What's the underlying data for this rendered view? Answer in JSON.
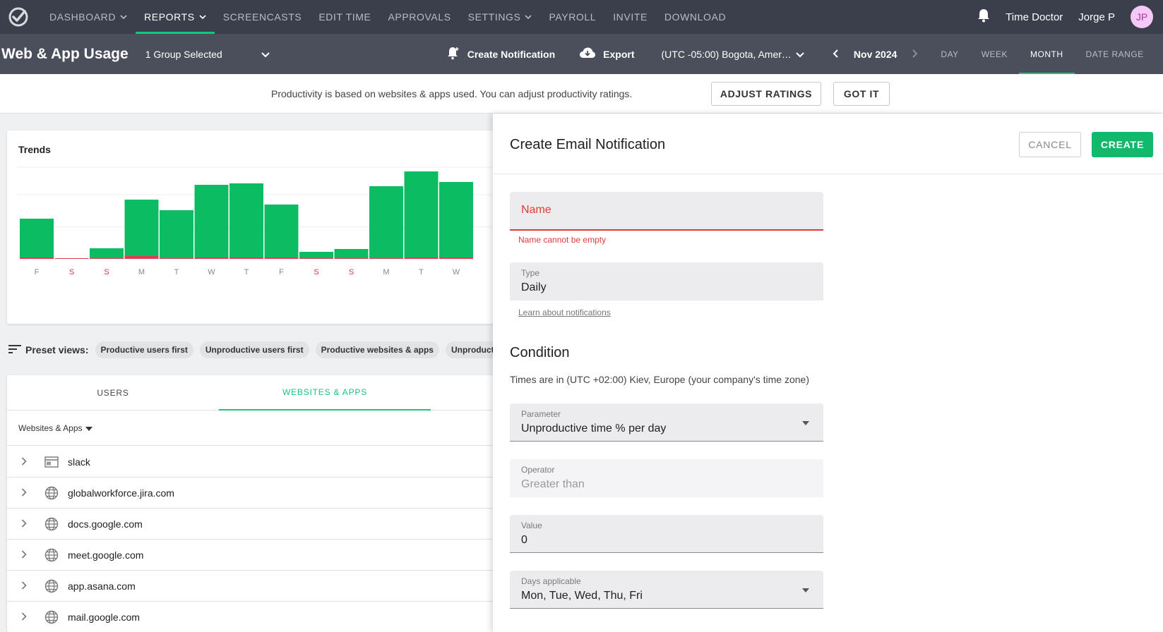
{
  "nav": {
    "items": [
      {
        "label": "DASHBOARD",
        "has_caret": true,
        "active": false
      },
      {
        "label": "REPORTS",
        "has_caret": true,
        "active": true
      },
      {
        "label": "SCREENCASTS",
        "has_caret": false,
        "active": false
      },
      {
        "label": "EDIT TIME",
        "has_caret": false,
        "active": false
      },
      {
        "label": "APPROVALS",
        "has_caret": false,
        "active": false
      },
      {
        "label": "SETTINGS",
        "has_caret": true,
        "active": false
      },
      {
        "label": "PAYROLL",
        "has_caret": false,
        "active": false
      },
      {
        "label": "INVITE",
        "has_caret": false,
        "active": false
      },
      {
        "label": "DOWNLOAD",
        "has_caret": false,
        "active": false
      }
    ],
    "company": "Time Doctor",
    "user_name": "Jorge P",
    "avatar_initials": "JP",
    "bell_icon": "bell-icon",
    "logo_icon": "time-doctor-logo"
  },
  "toolbar": {
    "title": "Web & App Usage",
    "group_select": "1 Group Selected",
    "create_notification": "Create Notification",
    "export": "Export",
    "timezone": "(UTC -05:00) Bogota, Amer…",
    "period": "Nov 2024",
    "range_tabs": [
      "DAY",
      "WEEK",
      "MONTH",
      "DATE RANGE"
    ],
    "active_range": "MONTH"
  },
  "infobar": {
    "text": "Productivity is based on websites & apps used. You can adjust productivity ratings.",
    "adjust_button": "ADJUST RATINGS",
    "got_it_button": "GOT IT"
  },
  "trends": {
    "title": "Trends"
  },
  "chart_data": {
    "type": "bar",
    "title": "Trends",
    "categories": [
      "F",
      "S",
      "S",
      "M",
      "T",
      "W",
      "T",
      "F",
      "S",
      "S",
      "M",
      "T",
      "W"
    ],
    "weekend": [
      false,
      true,
      true,
      false,
      false,
      false,
      false,
      false,
      true,
      true,
      false,
      false,
      false
    ],
    "series": [
      {
        "color": "#0cbc63",
        "values": [
          55,
          0,
          14,
          80,
          68,
          103,
          105,
          75,
          9,
          13,
          102,
          122,
          107
        ]
      },
      {
        "color": "#e53950",
        "values": [
          2,
          1,
          1,
          4,
          1,
          2,
          2,
          2,
          1,
          1,
          1,
          2,
          2
        ]
      }
    ],
    "ylim": [
      0,
      130
    ],
    "grid": true,
    "weekend_label_color": "#e5304f"
  },
  "presets": {
    "label": "Preset views:",
    "chips": [
      "Productive users first",
      "Unproductive users first",
      "Productive websites & apps",
      "Unproductive websites & apps"
    ]
  },
  "table": {
    "tabs": [
      "USERS",
      "WEBSITES & APPS"
    ],
    "active_tab": "WEBSITES & APPS",
    "filter_label": "Websites & Apps",
    "rows": [
      {
        "label": "slack",
        "icon": "app-window-icon"
      },
      {
        "label": "globalworkforce.jira.com",
        "icon": "globe-icon"
      },
      {
        "label": "docs.google.com",
        "icon": "globe-icon"
      },
      {
        "label": "meet.google.com",
        "icon": "globe-icon"
      },
      {
        "label": "app.asana.com",
        "icon": "globe-icon"
      },
      {
        "label": "mail.google.com",
        "icon": "globe-icon"
      }
    ]
  },
  "panel": {
    "title": "Create Email Notification",
    "cancel": "CANCEL",
    "create": "CREATE",
    "name_placeholder": "Name",
    "name_error": "Name cannot be empty",
    "type_label": "Type",
    "type_value": "Daily",
    "learn_link": "Learn about notifications",
    "condition_title": "Condition",
    "condition_desc": "Times are in (UTC +02:00) Kiev, Europe (your company's time zone)",
    "parameter_label": "Parameter",
    "parameter_value": "Unproductive time % per day",
    "operator_label": "Operator",
    "operator_value": "Greater than",
    "value_label": "Value",
    "value_value": "0",
    "days_label": "Days applicable",
    "days_value": "Mon, Tue, Wed, Thu, Fri"
  },
  "colors": {
    "accent": "#1bc47d",
    "nav_bg": "#3b3f4c",
    "toolbar_bg": "#4b4f5c",
    "error": "#e53935",
    "create_button": "#12b96c"
  }
}
